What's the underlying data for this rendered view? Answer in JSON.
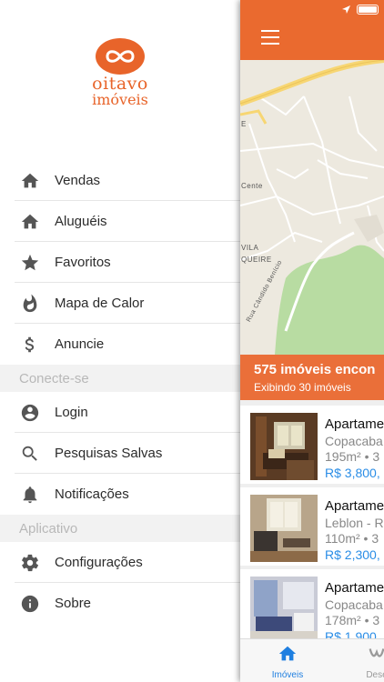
{
  "brand": {
    "line1": "oitavo",
    "line2": "imóveis",
    "color": "#e8642a"
  },
  "menu": {
    "main_items": [
      {
        "label": "Vendas",
        "icon": "home-icon"
      },
      {
        "label": "Aluguéis",
        "icon": "home-icon"
      },
      {
        "label": "Favoritos",
        "icon": "star-icon"
      },
      {
        "label": "Mapa de Calor",
        "icon": "flame-icon"
      },
      {
        "label": "Anuncie",
        "icon": "dollar-icon"
      }
    ],
    "section_connect": "Conecte-se",
    "connect_items": [
      {
        "label": "Login",
        "icon": "account-icon"
      },
      {
        "label": "Pesquisas Salvas",
        "icon": "search-icon"
      },
      {
        "label": "Notificações",
        "icon": "bell-icon"
      }
    ],
    "section_app": "Aplicativo",
    "app_items": [
      {
        "label": "Configurações",
        "icon": "gear-icon"
      },
      {
        "label": "Sobre",
        "icon": "info-icon"
      }
    ]
  },
  "map": {
    "labels": [
      "E",
      "Cente",
      "VILA",
      "QUEIRE",
      "Rua Cândido Benício"
    ]
  },
  "results": {
    "count_text": "575 imóveis encon",
    "showing_text": "Exibindo 30 imóveis"
  },
  "listings": [
    {
      "title": "Apartame",
      "location": "Copacaba",
      "area": "195m²",
      "beds": "3",
      "price": "R$ 3,800,"
    },
    {
      "title": "Apartame",
      "location": "Leblon - R",
      "area": "110m²",
      "beds": "3",
      "price": "R$ 2,300,"
    },
    {
      "title": "Apartame",
      "location": "Copacaba",
      "area": "178m²",
      "beds": "3",
      "price": "R$ 1,900,"
    }
  ],
  "tabbar": {
    "tabs": [
      {
        "label": "Imóveis",
        "icon": "home-icon",
        "active": true
      },
      {
        "label": "Dese",
        "icon": "wishlist-icon",
        "active": false
      }
    ]
  },
  "colors": {
    "accent": "#ea6a2f",
    "price": "#2a8de6",
    "active_tab": "#1f7fe0"
  }
}
